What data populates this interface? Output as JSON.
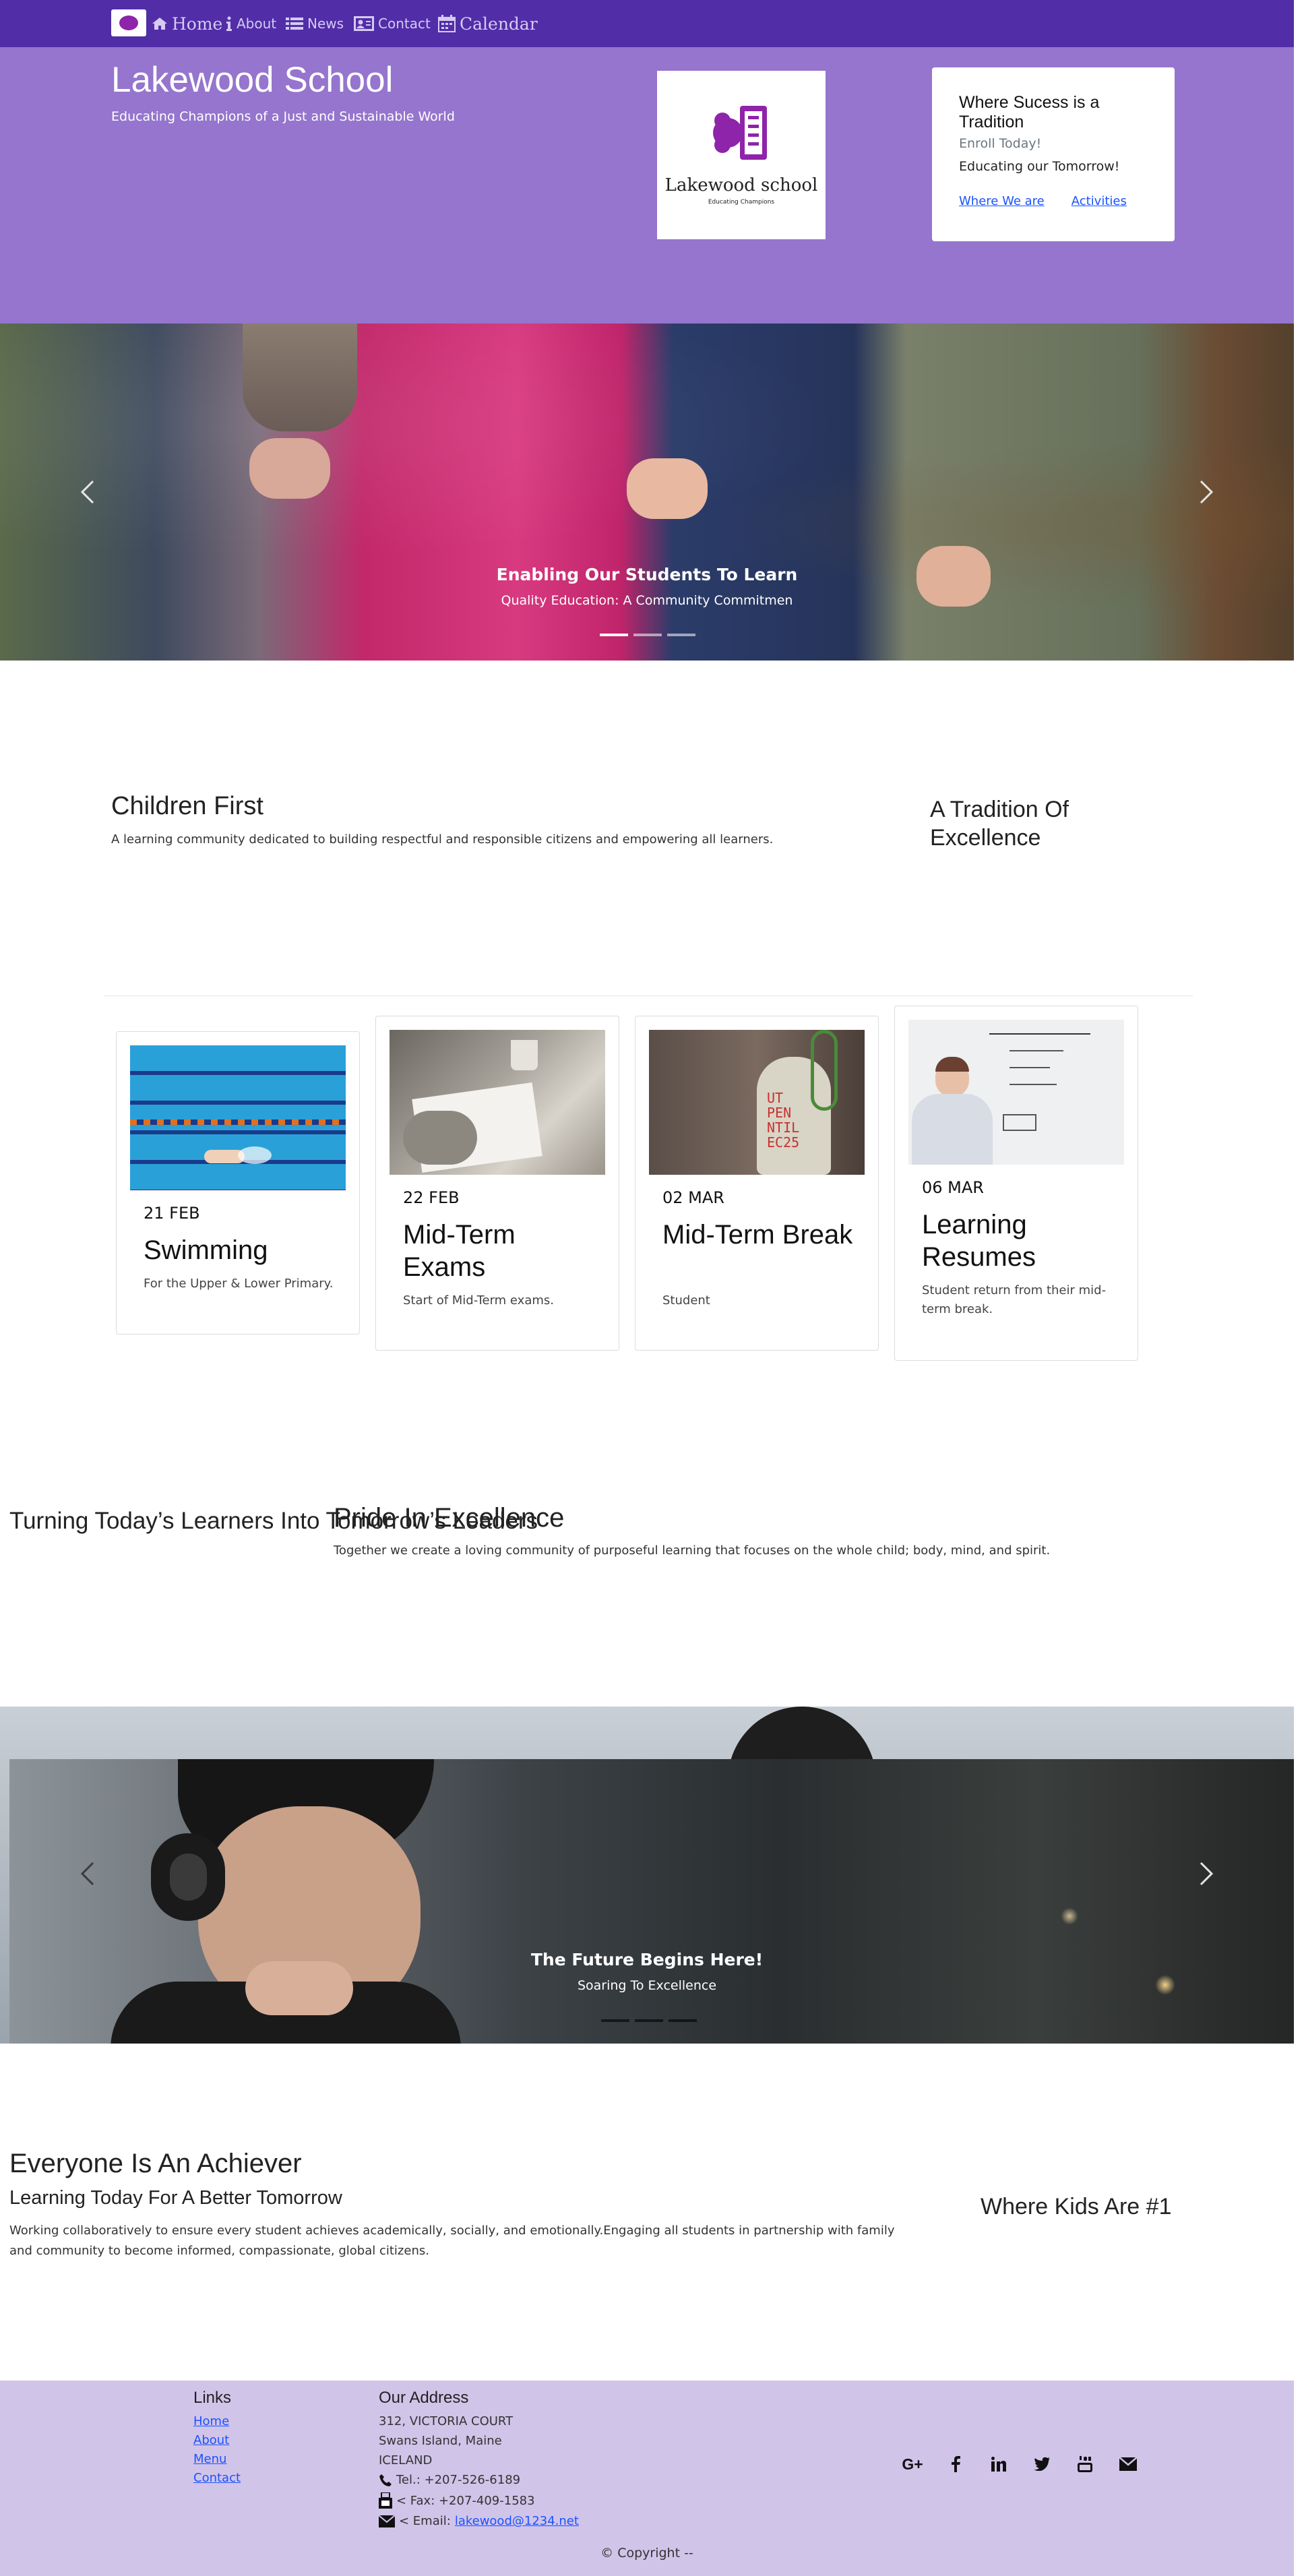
{
  "nav": {
    "items": [
      {
        "label": "Home",
        "icon": "home-icon"
      },
      {
        "label": "About",
        "icon": "info-icon"
      },
      {
        "label": "News",
        "icon": "list-icon"
      },
      {
        "label": "Contact",
        "icon": "contact-card-icon"
      },
      {
        "label": "Calendar",
        "icon": "calendar-icon"
      }
    ],
    "colors": {
      "bar": "#512da8",
      "text": "#d6caf2"
    }
  },
  "header": {
    "title": "Lakewood School",
    "subtitle": "Educating Champions of a Just and Sustainable World",
    "logo": {
      "name": "Lakewood school",
      "tagline": "Educating Champions"
    },
    "card": {
      "title": "Where Sucess is a Tradition",
      "enroll": "Enroll Today!",
      "tagline": "Educating our Tomorrow!",
      "links": [
        "Where We are",
        "Activities"
      ]
    },
    "colors": {
      "background": "#9575cd",
      "logo_accent": "#8e24aa"
    }
  },
  "carousel1": {
    "caption_title": "Enabling Our Students To Learn",
    "caption_sub": "Quality Education: A Community Commitmen"
  },
  "intro": {
    "heading": "Children First",
    "text": "A learning community dedicated to building respectful and responsible citizens and empowering all learners.",
    "side_heading": "A Tradition Of Excellence"
  },
  "events": [
    {
      "date": "21 FEB",
      "title": "Swimming",
      "desc": "For the Upper & Lower Primary."
    },
    {
      "date": "22 FEB",
      "title": "Mid-Term Exams",
      "desc": "Start of Mid-Term exams."
    },
    {
      "date": "02 MAR",
      "title": "Mid-Term Break",
      "desc": "Student"
    },
    {
      "date": "06 MAR",
      "title": "Learning Resumes",
      "desc": "Student return from their mid-term break."
    }
  ],
  "pride": {
    "side_heading": "Turning Today’s Learners Into Tomorrow’s Leaders",
    "heading": "Pride In Excellence",
    "text": "Together we create a loving community of purposeful learning that focuses on the whole child; body, mind, and spirit."
  },
  "carousel2": {
    "caption_title": "The Future Begins Here!",
    "caption_sub": "Soaring To Excellence"
  },
  "achiever": {
    "heading": "Everyone Is An Achiever",
    "subheading": "Learning Today For A Better Tomorrow",
    "text": "Working collaboratively to ensure every student achieves academically, socially, and emotionally.Engaging all students in partnership with family and community to become informed, compassionate, global citizens.",
    "side_heading": "Where Kids Are #1"
  },
  "footer": {
    "links_heading": "Links",
    "links": [
      "Home",
      "About",
      "Menu",
      "Contact"
    ],
    "address_heading": "Our Address",
    "address": [
      "312, VICTORIA COURT",
      "Swans Island, Maine",
      "ICELAND"
    ],
    "tel": "Tel.: +207-526-6189",
    "fax": "< Fax: +207-409-1583",
    "email_label": "< Email: ",
    "email": "lakewood@1234.net",
    "social_icons": [
      "google-plus-icon",
      "facebook-icon",
      "linkedin-icon",
      "twitter-icon",
      "youtube-icon",
      "envelope-icon"
    ],
    "google_plus_text": "G+",
    "copyright": "© Copyright --",
    "colors": {
      "background": "#d1c4e9"
    }
  }
}
